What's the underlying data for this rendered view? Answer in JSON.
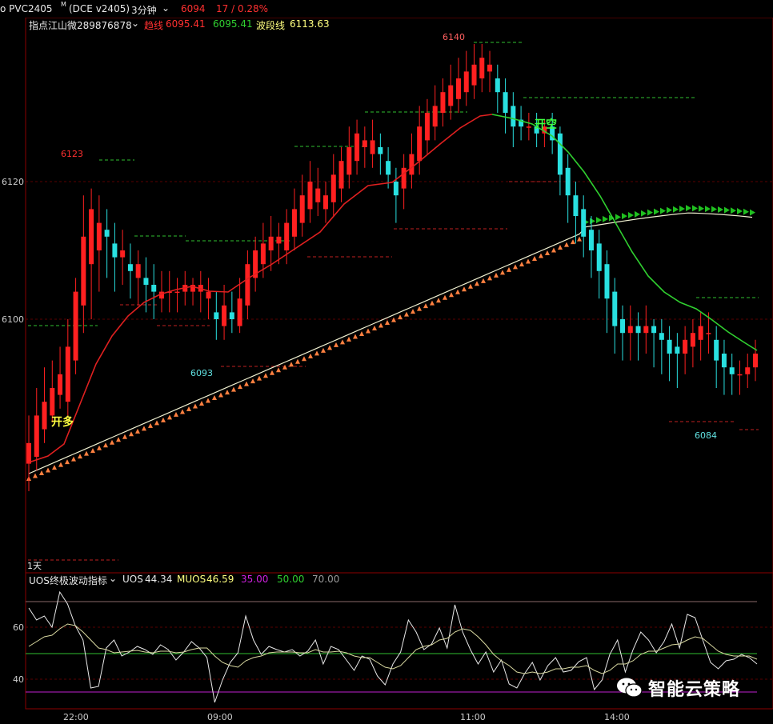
{
  "header": {
    "symbol": "o PVC2405",
    "symbol_mark": "M",
    "exchange_code": "(DCE v2405)",
    "period": "3分钟",
    "last_price": "6094",
    "change": "17 / 0.28%"
  },
  "indicator_bar": {
    "name": "指点江山微289876878",
    "line1_label": "趋线",
    "line1_value": "6095.41",
    "line2_value": "6095.41",
    "line3_label": "波段线",
    "line3_value": "6113.63"
  },
  "annotations": {
    "open_long": "开多",
    "open_short": "开空",
    "high_label": "6140",
    "low_label_1": "6093",
    "low_label_2": "6084",
    "red_label": "6123",
    "bottom_tag": "1天"
  },
  "price_axis": {
    "ticks": [
      "6120",
      "6100"
    ]
  },
  "sub_indicator": {
    "name": "UOS终极波动指标",
    "uos_label": "UOS",
    "uos_value": "44.34",
    "muos_label": "MUOS",
    "muos_value": "46.59",
    "level1": "35.00",
    "level2": "50.00",
    "level3": "70.00",
    "ticks": [
      "60",
      "40"
    ]
  },
  "time_axis": {
    "ticks": [
      "22:00",
      "09:00",
      "11:00",
      "14:00"
    ]
  },
  "watermark": {
    "text": "智能云策略"
  },
  "colors": {
    "up": "#ff2020",
    "down": "#29e0e0",
    "trend_red": "#e02020",
    "trend_green": "#30d030",
    "band": "#ff8040",
    "text_yellow": "#ffff40",
    "text_orange": "#ff9d3d",
    "purple": "#d020e0"
  }
}
